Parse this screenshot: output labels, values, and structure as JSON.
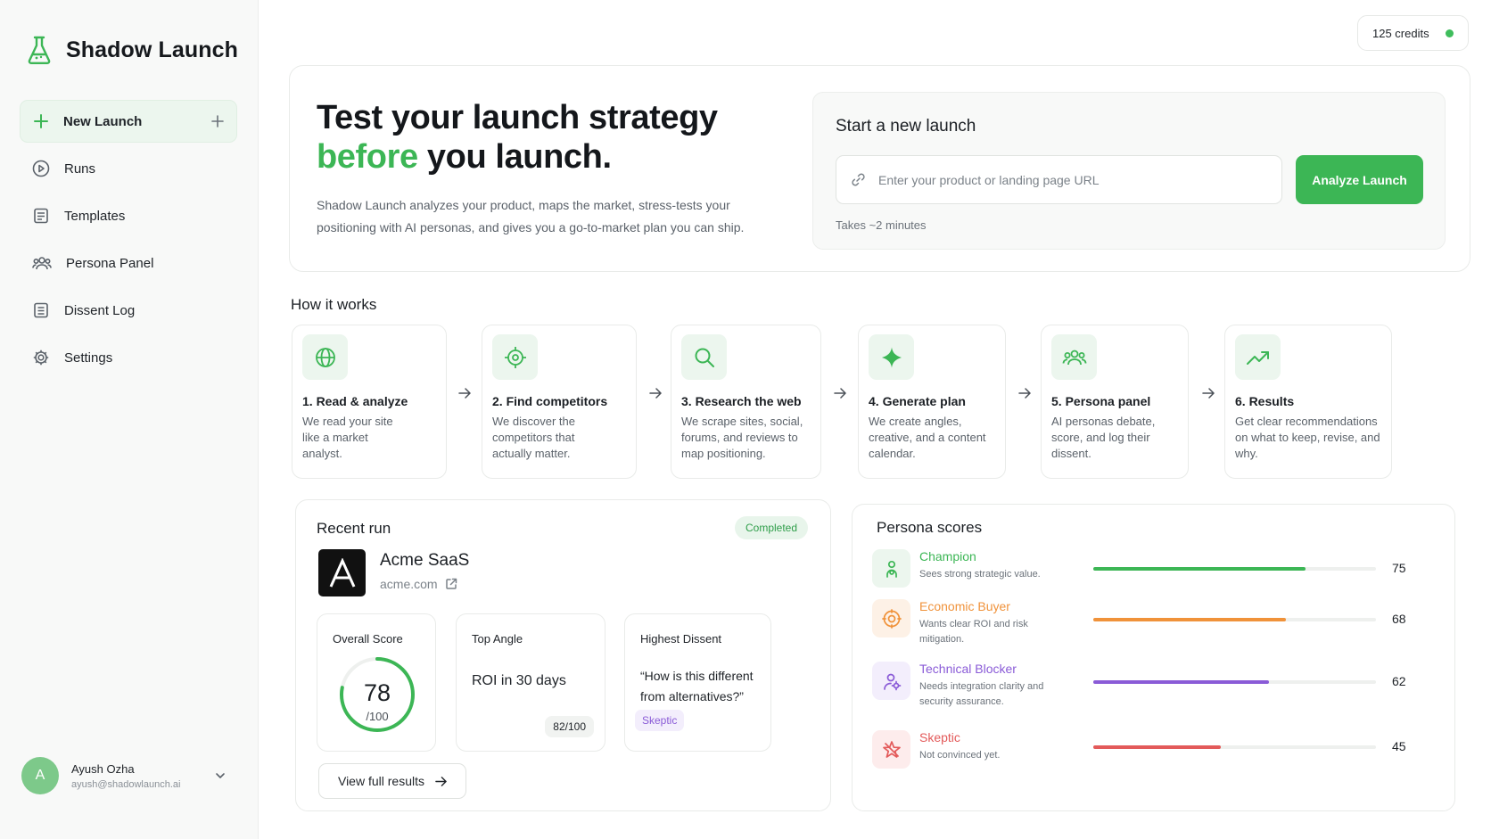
{
  "app": {
    "name": "Shadow Launch"
  },
  "sidebar": {
    "items": [
      {
        "label": "New Launch",
        "icon": "plus-icon"
      },
      {
        "label": "Runs",
        "icon": "play-circle-icon"
      },
      {
        "label": "Templates",
        "icon": "template-icon"
      },
      {
        "label": "Persona Panel",
        "icon": "users-icon"
      },
      {
        "label": "Dissent Log",
        "icon": "log-icon"
      },
      {
        "label": "Settings",
        "icon": "gear-icon"
      }
    ],
    "user": {
      "initial": "A",
      "name": "Ayush Ozha",
      "email": "ayush@shadowlaunch.ai"
    }
  },
  "credits": {
    "label": "125 credits"
  },
  "hero": {
    "title_line1": "Test your launch strategy",
    "title_accent": "before",
    "title_rest": " you launch.",
    "description": "Shadow Launch analyzes your product, maps the market, stress-tests your positioning with AI personas, and gives you a go-to-market plan you can ship."
  },
  "launch": {
    "title": "Start a new launch",
    "placeholder": "Enter your product or landing page URL",
    "value": "",
    "button": "Analyze Launch",
    "note": "Takes ~2 minutes"
  },
  "how": {
    "title": "How it works",
    "steps": [
      {
        "title": "1. Read & analyze",
        "desc": "We read your site like a market analyst.",
        "icon": "globe-icon"
      },
      {
        "title": "2. Find competitors",
        "desc": "We discover the competitors that actually matter.",
        "icon": "target-icon"
      },
      {
        "title": "3. Research the web",
        "desc": "We scrape sites, social, forums, and reviews to map positioning.",
        "icon": "search-icon"
      },
      {
        "title": "4. Generate plan",
        "desc": "We create angles, creative, and a content calendar.",
        "icon": "sparkle-icon"
      },
      {
        "title": "5. Persona panel",
        "desc": "AI personas debate, score, and log their dissent.",
        "icon": "users-icon"
      },
      {
        "title": "6. Results",
        "desc": "Get clear recommendations on what to keep, revise, and why.",
        "icon": "trend-up-icon"
      }
    ]
  },
  "recent": {
    "title": "Recent run",
    "status": "Completed",
    "product": {
      "logo_letter": "A",
      "name": "Acme SaaS",
      "url": "acme.com"
    },
    "overall": {
      "label": "Overall Score",
      "value": "78",
      "denominator": "/100",
      "fraction": 0.78
    },
    "angle": {
      "label": "Top Angle",
      "value": "ROI in 30 days",
      "score": "82/100"
    },
    "dissent": {
      "label": "Highest Dissent",
      "quote": "“How is this different from alternatives?”",
      "tag": "Skeptic"
    },
    "button": "View full results"
  },
  "personas": {
    "title": "Persona scores",
    "items": [
      {
        "name": "Champion",
        "desc": "Sees strong strategic value.",
        "score": "75",
        "value": 75,
        "color": "#3cb655",
        "bg": "#ecf6ee",
        "icon": "champion-icon"
      },
      {
        "name": "Economic Buyer",
        "desc": "Wants clear ROI and risk mitigation.",
        "score": "68",
        "value": 68,
        "color": "#f0923a",
        "bg": "#fdf1e6",
        "icon": "coin-icon"
      },
      {
        "name": "Technical Blocker",
        "desc": "Needs integration clarity and security assurance.",
        "score": "62",
        "value": 62,
        "color": "#8a5bd7",
        "bg": "#f3eefc",
        "icon": "user-gear-icon"
      },
      {
        "name": "Skeptic",
        "desc": "Not convinced yet.",
        "score": "45",
        "value": 45,
        "color": "#e35a5a",
        "bg": "#fdecec",
        "icon": "skeptic-icon"
      }
    ]
  }
}
